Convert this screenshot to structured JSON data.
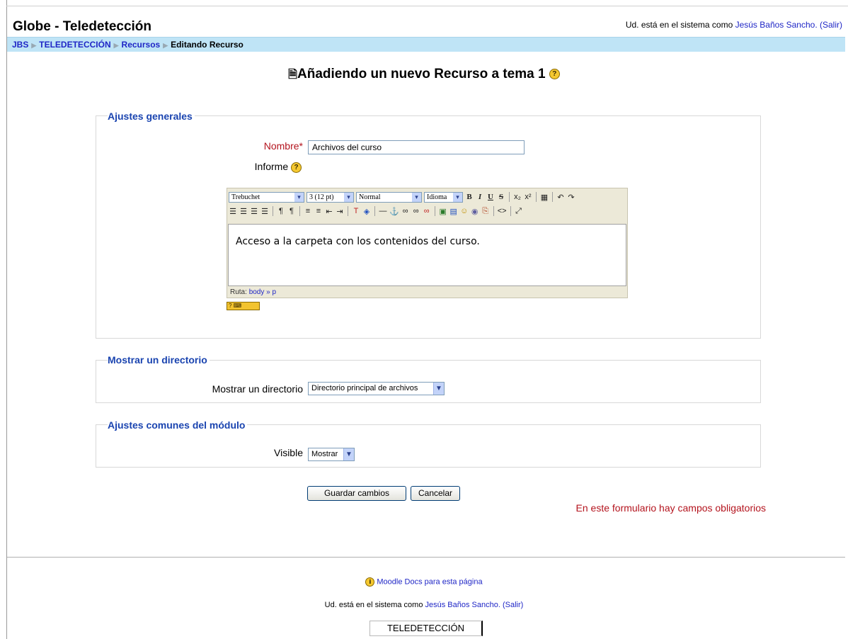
{
  "header": {
    "site_title": "Globe - Teledetección",
    "login_prefix": "Ud. está en el sistema como ",
    "user_name": "Jesús Baños Sancho.",
    "logout": "(Salir)"
  },
  "breadcrumb": {
    "items": [
      "JBS",
      "TELEDETECCIÓN",
      "Recursos"
    ],
    "separator": "▶",
    "current": "Editando Recurso"
  },
  "page_title": "Añadiendo un nuevo Recurso a tema 1",
  "sections": {
    "general": "Ajustes generales",
    "directory": "Mostrar un directorio",
    "common": "Ajustes comunes del módulo"
  },
  "form": {
    "name_label": "Nombre",
    "required_mark": "*",
    "name_value": "Archivos del curso",
    "summary_label": "Informe",
    "directory_label": "Mostrar un directorio",
    "directory_value": "Directorio principal de archivos",
    "visible_label": "Visible",
    "visible_value": "Mostrar"
  },
  "editor": {
    "font": "Trebuchet",
    "size": "3 (12 pt)",
    "format": "Normal",
    "language": "Idioma",
    "content": "Acceso a la carpeta con los contenidos del curso.",
    "path_label": "Ruta:",
    "path_value": "body » p"
  },
  "buttons": {
    "save": "Guardar cambios",
    "cancel": "Cancelar"
  },
  "required_note": "En este formulario hay campos obligatorios",
  "footer": {
    "docs_link": "Moodle Docs para esta página",
    "login_prefix": "Ud. está en el sistema como ",
    "user_name": "Jesús Baños Sancho.",
    "logout": "(Salir)",
    "course_box": "TELEDETECCIÓN"
  },
  "colors": {
    "navbar_bg": "#bfe4f6",
    "link": "#1f26c6",
    "legend": "#1a44b0",
    "required": "#b4141e"
  }
}
